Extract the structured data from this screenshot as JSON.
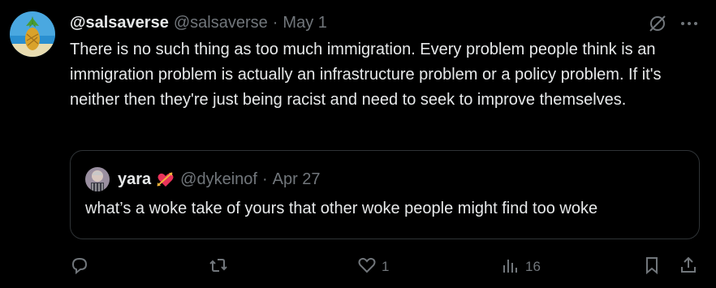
{
  "tweet": {
    "display_name": "@salsaverse",
    "handle": "@salsaverse",
    "separator": "·",
    "date": "May 1",
    "text": "There is no such thing as too much immigration. Every problem people think is an immigration problem is actually an infrastructure problem or a policy problem. If it's neither then they're just being racist and need to seek to improve themselves."
  },
  "quote": {
    "display_name": "yara",
    "emoji": "heart-with-arrow-emoji",
    "handle": "@dykeinof",
    "separator": "·",
    "date": "Apr 27",
    "text": "what’s a woke take of yours that other woke people might find too woke"
  },
  "actions": {
    "reply_count": "",
    "retweet_count": "",
    "like_count": "1",
    "views_count": "16"
  },
  "icons": [
    "grok-icon",
    "more-icon",
    "reply-icon",
    "retweet-icon",
    "like-icon",
    "views-icon",
    "bookmark-icon",
    "share-icon"
  ],
  "colors": {
    "background": "#000000",
    "text": "#e7e9ea",
    "secondary": "#71767b",
    "border": "#2f3336"
  }
}
